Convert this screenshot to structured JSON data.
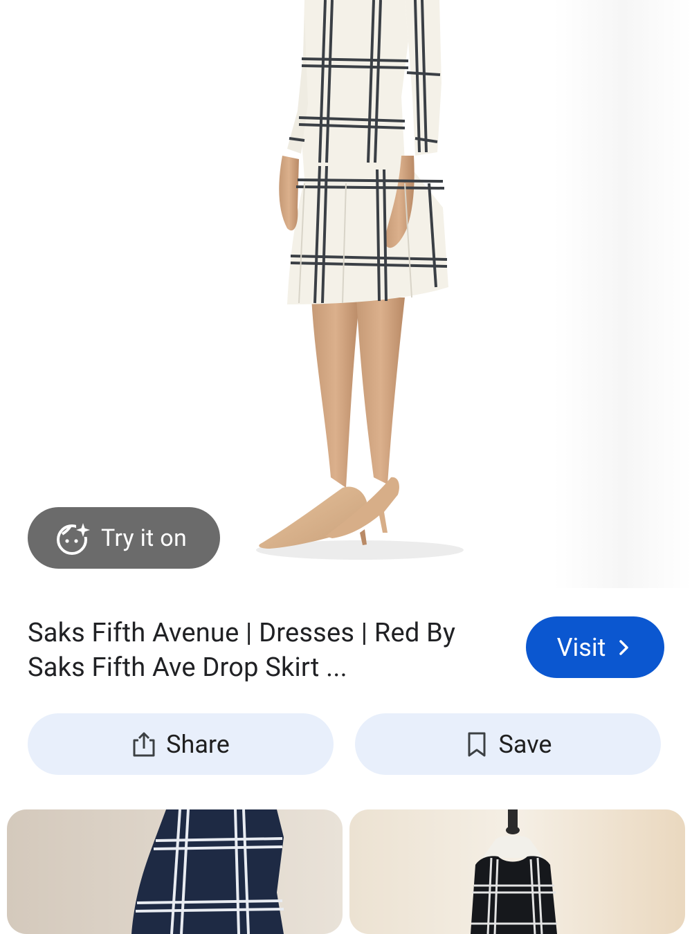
{
  "hero": {
    "try_on_label": "Try it on"
  },
  "product": {
    "title": "Saks Fifth Avenue | Dresses | Red By Saks Fifth Ave Drop Skirt ..."
  },
  "actions": {
    "visit_label": "Visit",
    "share_label": "Share",
    "save_label": "Save"
  },
  "icons": {
    "try_on": "face-sparkle-icon",
    "visit": "chevron-right-icon",
    "share": "share-icon",
    "save": "bookmark-icon"
  },
  "colors": {
    "visit_button": "#0b57d0",
    "pill_background": "#e8effb",
    "try_on_chip": "#6b6b6b"
  }
}
